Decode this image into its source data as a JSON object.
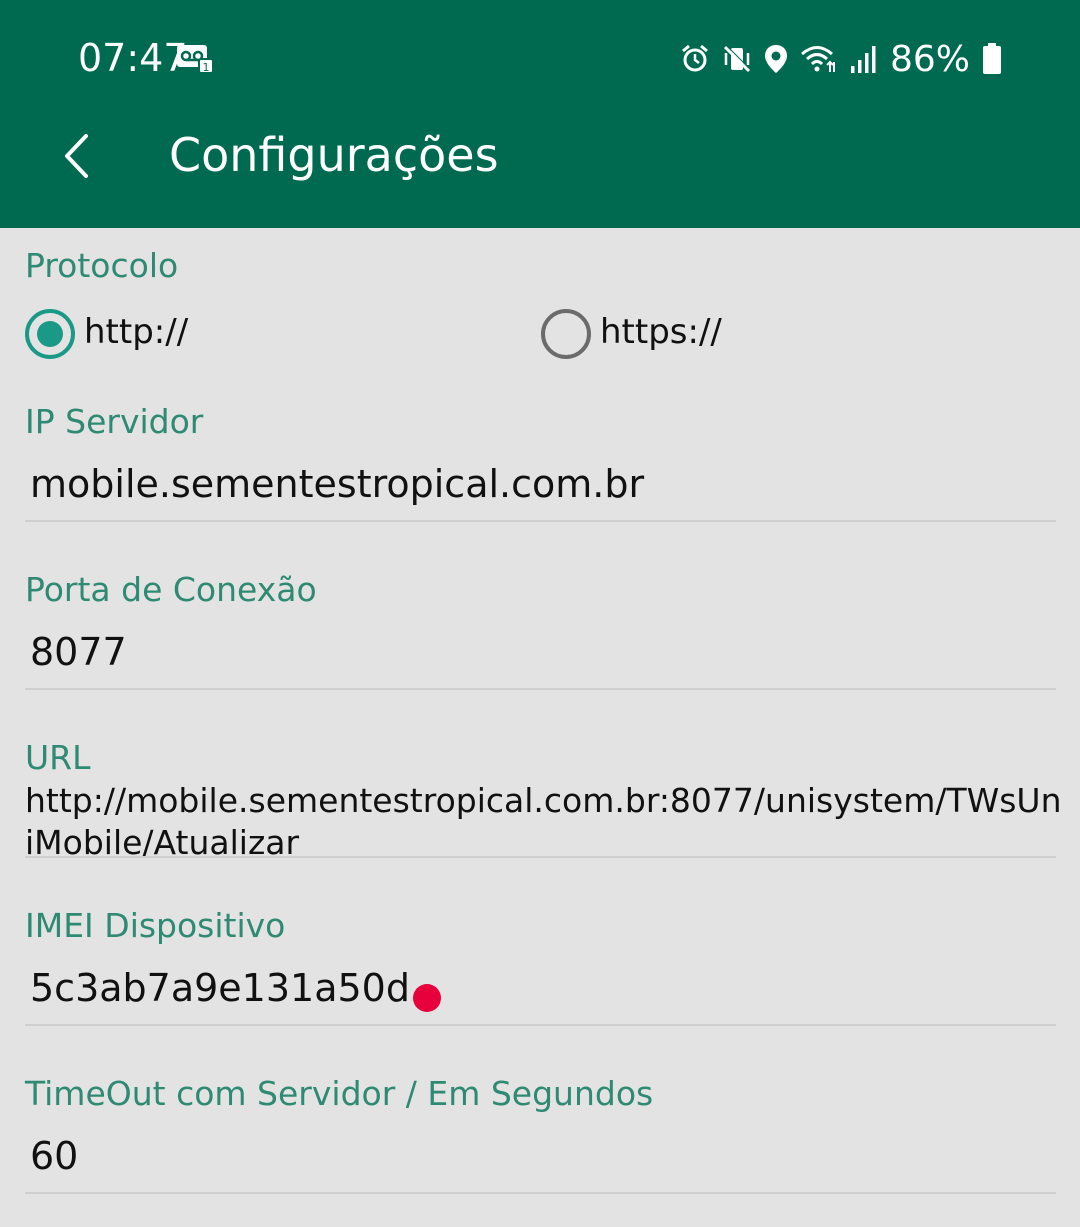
{
  "status_bar": {
    "time": "07:47",
    "battery": "86%"
  },
  "header": {
    "title": "Configurações"
  },
  "protocol": {
    "label": "Protocolo",
    "options": [
      "http://",
      "https://"
    ],
    "selected": "http://"
  },
  "server_ip": {
    "label": "IP Servidor",
    "value": "mobile.sementestropical.com.br"
  },
  "port": {
    "label": "Porta de Conexão",
    "value": "8077"
  },
  "url": {
    "label": "URL",
    "value": "http://mobile.sementestropical.com.br:8077/unisystem/TWsUniMobile/Atualizar"
  },
  "imei": {
    "label": "IMEI Dispositivo",
    "value": "5c3ab7a9e131a50d"
  },
  "timeout": {
    "label": "TimeOut com Servidor / Em Segundos",
    "value": "60"
  },
  "colors": {
    "header_bg": "#006a50",
    "label": "#2e8a72",
    "radio_accent": "#1a9a86",
    "marker": "#e8003c"
  }
}
